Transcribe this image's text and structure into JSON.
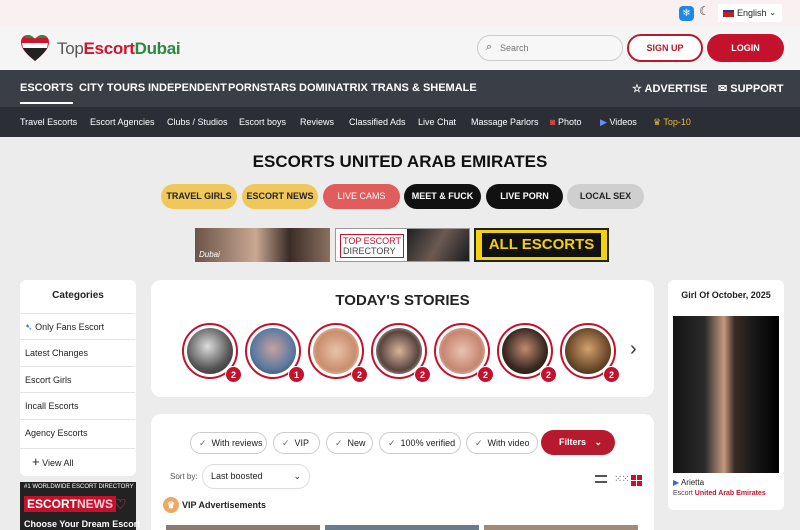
{
  "topbar": {
    "language": "English"
  },
  "logo": {
    "part1": "Top",
    "part2": "Escort",
    "part3": "Dubai"
  },
  "search": {
    "placeholder": "Search"
  },
  "auth": {
    "signup": "SIGN UP",
    "login": "LOGIN"
  },
  "nav_main": [
    "ESCORTS",
    "CITY TOURS",
    "INDEPENDENT",
    "PORNSTARS",
    "DOMINATRIX",
    "TRANS & SHEMALE"
  ],
  "nav_right": {
    "advertise": "ADVERTISE",
    "support": "SUPPORT"
  },
  "nav_sub": [
    "Travel Escorts",
    "Escort Agencies",
    "Clubs / Studios",
    "Escort boys",
    "Reviews",
    "Classified Ads",
    "Live Chat",
    "Massage Parlors",
    "Photo",
    "Videos",
    "Top-10"
  ],
  "page_title": "ESCORTS UNITED ARAB EMIRATES",
  "pills": [
    "TRAVEL GIRLS",
    "ESCORT NEWS",
    "LIVE CAMS",
    "MEET & FUCK",
    "LIVE PORN",
    "LOCAL SEX"
  ],
  "banners": {
    "b1": "Dubai",
    "b2_line1": "TOP ESCORT",
    "b2_line2": "DIRECTORY",
    "b3": "ALL ESCORTS"
  },
  "categories": {
    "title": "Categories",
    "items": [
      "Only Fans Escort",
      "Latest Changes",
      "Escort Girls",
      "Incall Escorts",
      "Agency Escorts"
    ],
    "view_all": "View All"
  },
  "promo": {
    "tag": "#1 WORLDWIDE ESCORT DIRECTORY",
    "brand1": "ESCORT",
    "brand2": "NEWS",
    "cta": "Choose Your Dream Escort"
  },
  "stories": {
    "title": "TODAY'S STORIES",
    "counts": [
      "2",
      "1",
      "2",
      "2",
      "2",
      "2",
      "2"
    ]
  },
  "filters": {
    "chips": [
      "With reviews",
      "VIP",
      "New",
      "100% verified",
      "With video"
    ],
    "button": "Filters",
    "sort_label": "Sort by:",
    "sort_value": "Last boosted",
    "vip_heading": "VIP Advertisements"
  },
  "girl_of_month": {
    "title": "Girl Of October, 2025",
    "name": "Arietta",
    "label": "Escort",
    "location": "United Arab Emirates"
  },
  "colors": {
    "accent": "#c4122c",
    "nav_dark": "#3a3f47",
    "nav_darker": "#2b2f35",
    "pill_yellow": "#f0c75a"
  }
}
